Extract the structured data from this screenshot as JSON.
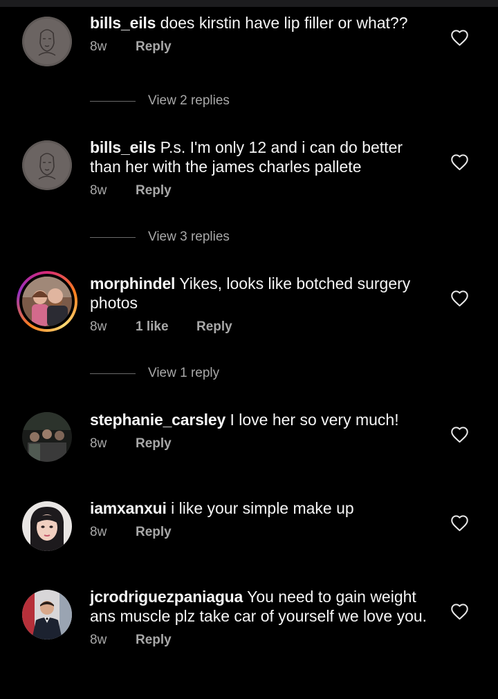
{
  "comments": [
    {
      "username": "bills_eils",
      "text": "does kirstin have lip filler or what??",
      "time": "8w",
      "likes": "",
      "reply_label": "Reply",
      "view_replies": "View 2 replies"
    },
    {
      "username": "bills_eils",
      "text": "P.s. I'm only 12 and i can do better than her with the james charles pallete",
      "time": "8w",
      "likes": "",
      "reply_label": "Reply",
      "view_replies": "View 3 replies"
    },
    {
      "username": "morphindel",
      "text": "Yikes, looks like botched surgery photos",
      "time": "8w",
      "likes": "1 like",
      "reply_label": "Reply",
      "view_replies": "View 1 reply"
    },
    {
      "username": "stephanie_carsley",
      "text": "I love her so very much!",
      "time": "8w",
      "likes": "",
      "reply_label": "Reply",
      "view_replies": ""
    },
    {
      "username": "iamxanxui",
      "text": "i like your simple make up",
      "time": "8w",
      "likes": "",
      "reply_label": "Reply",
      "view_replies": ""
    },
    {
      "username": "jcrodriguezpaniagua",
      "text": "You need to gain weight ans muscle plz take car of yourself we love you.",
      "time": "8w",
      "likes": "",
      "reply_label": "Reply",
      "view_replies": ""
    }
  ],
  "icons": {
    "like": "heart-outline-icon"
  },
  "colors": {
    "background": "#000000",
    "secondary_text": "#a8a8a8",
    "primary_text": "#f5f5f5"
  }
}
